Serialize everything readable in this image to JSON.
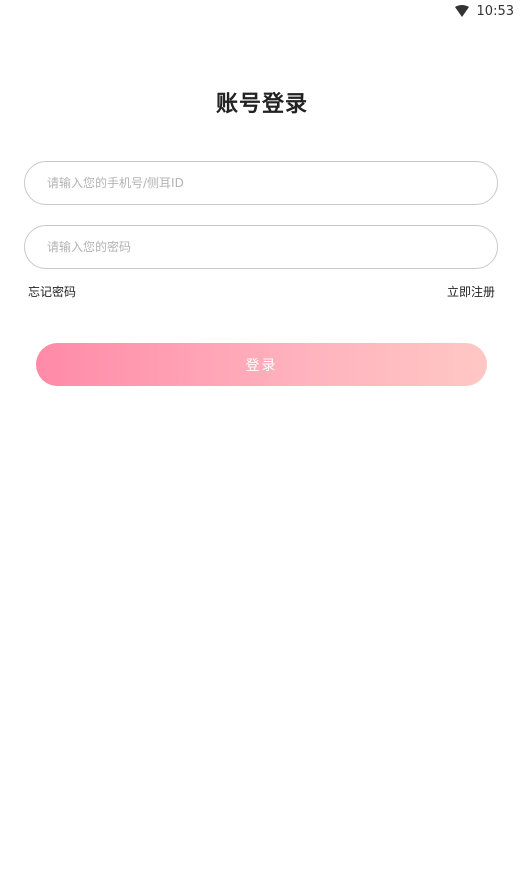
{
  "status_bar": {
    "time": "10:53"
  },
  "title": "账号登录",
  "form": {
    "account_placeholder": "请输入您的手机号/侧耳ID",
    "account_value": "",
    "password_placeholder": "请输入您的密码",
    "password_value": "",
    "forgot_password": "忘记密码",
    "register": "立即注册",
    "login_button": "登录"
  },
  "colors": {
    "button_gradient_start": "#ff8aa8",
    "button_gradient_end": "#ffc7c4",
    "field_border": "#c9c9c9"
  }
}
